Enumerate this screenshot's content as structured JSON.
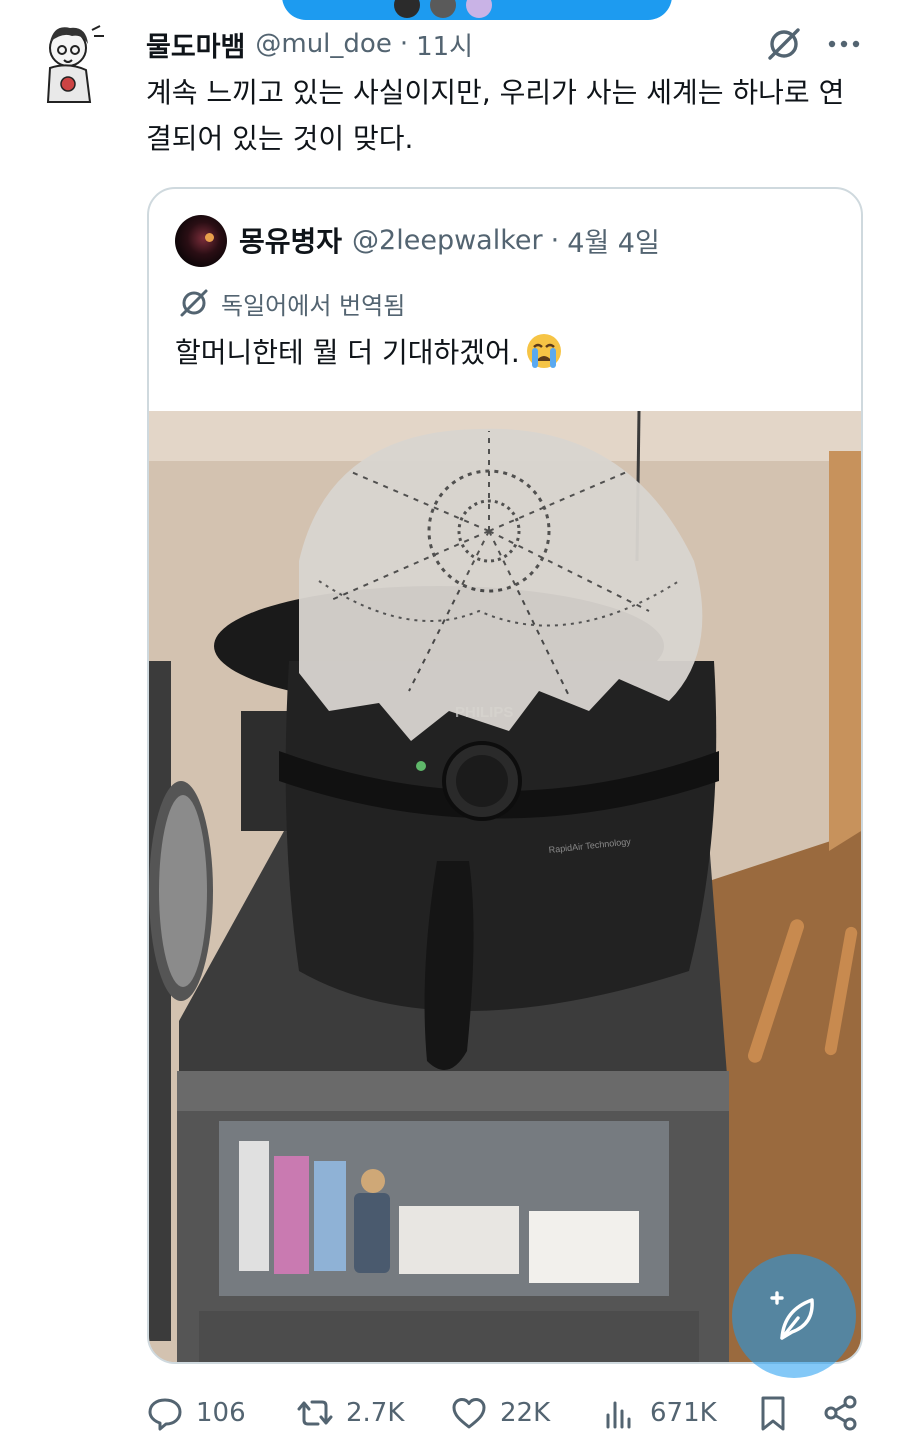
{
  "post": {
    "display_name": "물도마뱀",
    "handle": "@mul_doe",
    "separator": "·",
    "time": "11시",
    "text": "계속 느끼고 있는 사실이지만, 우리가 사는 세계는 하나로 연결되어 있는 것이 맞다."
  },
  "quoted_post": {
    "display_name": "몽유병자",
    "handle": "@2leepwalker",
    "separator": "·",
    "time": "4월 4일",
    "translation_label": "독일어에서 번역됨",
    "text": "할머니한테 뭘 더 기대하겠어.",
    "photo_text": {
      "brand": "PHILIPS",
      "tech_label": "RapidAir Technology"
    }
  },
  "actions": {
    "replies": "106",
    "reposts": "2.7K",
    "likes": "22K",
    "views": "671K"
  },
  "icons": [
    "grok-icon",
    "more-icon",
    "translate-icon",
    "crying-face-emoji",
    "compose-icon",
    "reply-icon",
    "repost-icon",
    "like-icon",
    "views-icon",
    "bookmark-icon",
    "share-icon"
  ],
  "colors": {
    "accent": "#1d9bf0",
    "text_primary": "#0f1419",
    "text_secondary": "#536471",
    "border": "#cfd9de"
  }
}
